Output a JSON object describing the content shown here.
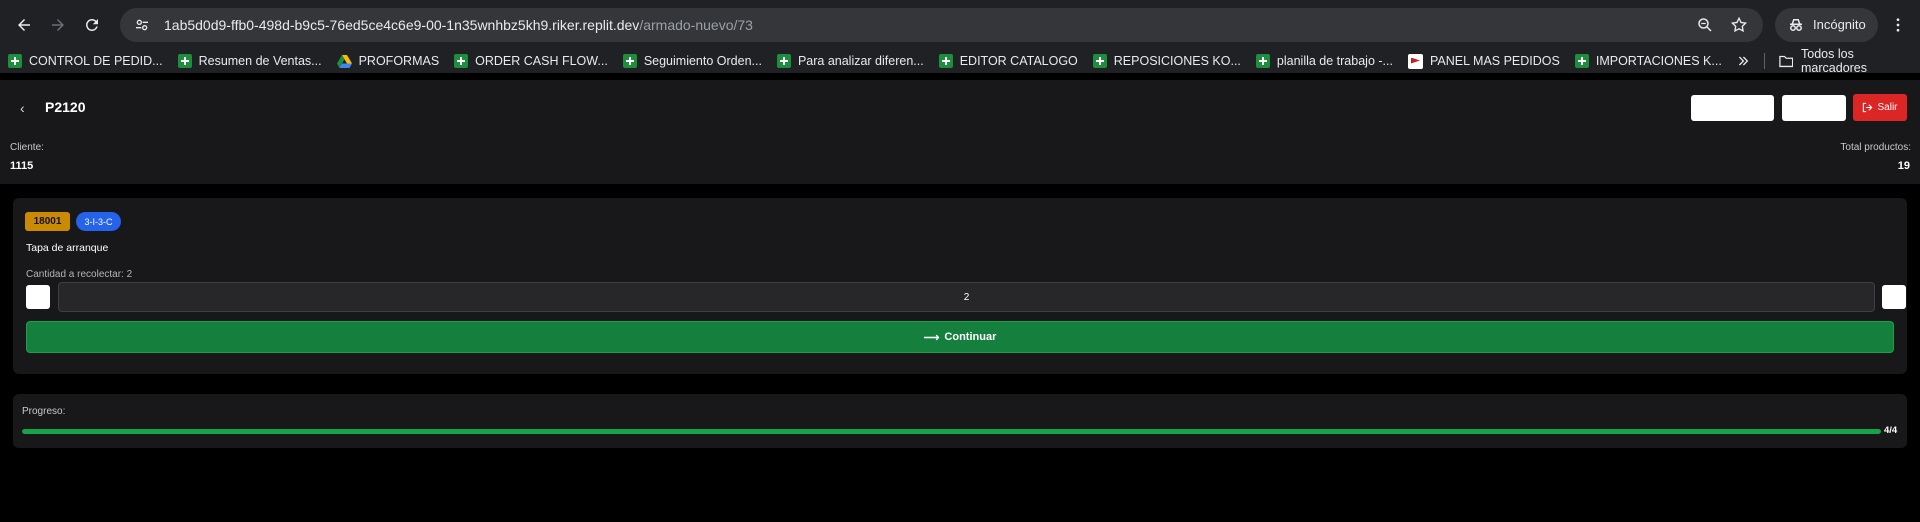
{
  "browser": {
    "url_host": "1ab5d0d9-ffb0-498d-b9c5-76ed5ce4c6e9-00-1n35wnhbz5kh9.riker.replit.dev",
    "url_path": "/armado-nuevo/73",
    "incognito_label": "Incógnito"
  },
  "bookmarks": {
    "items": [
      {
        "label": "CONTROL DE PEDID...",
        "icon": "sheets-icon"
      },
      {
        "label": "Resumen de Ventas...",
        "icon": "sheets-icon"
      },
      {
        "label": "PROFORMAS",
        "icon": "drive-icon"
      },
      {
        "label": "ORDER CASH FLOW...",
        "icon": "sheets-icon"
      },
      {
        "label": "Seguimiento Orden...",
        "icon": "sheets-icon"
      },
      {
        "label": "Para analizar diferen...",
        "icon": "sheets-icon"
      },
      {
        "label": "EDITOR CATALOGO",
        "icon": "sheets-icon"
      },
      {
        "label": "REPOSICIONES KO...",
        "icon": "sheets-icon"
      },
      {
        "label": "planilla de trabajo -...",
        "icon": "sheets-icon"
      },
      {
        "label": "PANEL MAS PEDIDOS",
        "icon": "panel-icon"
      },
      {
        "label": "IMPORTACIONES K...",
        "icon": "sheets-icon"
      }
    ],
    "all_label": "Todos los marcadores"
  },
  "header": {
    "order_id": "P2120",
    "exit_label": "Salir",
    "cliente_label": "Cliente:",
    "cliente_value": "1115",
    "total_label": "Total productos:",
    "total_value": "19"
  },
  "item": {
    "code": "18001",
    "location": "3-I-3-C",
    "name": "Tapa de arranque",
    "qty_label": "Cantidad a recolectar: 2",
    "qty_value": "2",
    "continue_label": "Continuar"
  },
  "progress": {
    "label": "Progreso:",
    "count": "4/4",
    "fraction": 1.0
  },
  "colors": {
    "accent_green": "#15803d",
    "exit_red": "#dc2626",
    "code_badge": "#ca8a04",
    "location_badge": "#2563eb"
  }
}
